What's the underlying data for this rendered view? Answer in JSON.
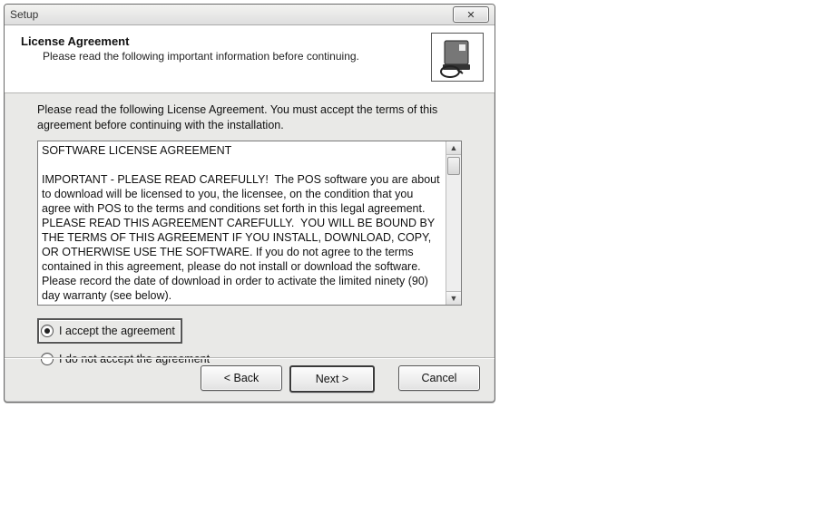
{
  "window": {
    "title": "Setup"
  },
  "header": {
    "title": "License Agreement",
    "subtitle": "Please read the following important information before continuing."
  },
  "intro": "Please read the following License Agreement. You must accept the terms of this agreement before continuing with the installation.",
  "license_text": "SOFTWARE LICENSE AGREEMENT\n\nIMPORTANT - PLEASE READ CAREFULLY!  The POS software you are about to download will be licensed to you, the licensee, on the condition that you agree with POS to the terms and conditions set forth in this legal agreement.  PLEASE READ THIS AGREEMENT CAREFULLY.  YOU WILL BE BOUND BY THE TERMS OF THIS AGREEMENT IF YOU INSTALL, DOWNLOAD, COPY, OR OTHERWISE USE THE SOFTWARE. If you do not agree to the terms contained in this agreement, please do not install or download the software.  Please record the date of download in order to activate the limited ninety (90) day warranty (see below).",
  "radios": {
    "accept": "I accept the agreement",
    "decline": "I do not accept the agreement",
    "selected": "accept"
  },
  "buttons": {
    "back": "< Back",
    "next": "Next >",
    "cancel": "Cancel"
  },
  "icons": {
    "close": "✕"
  }
}
